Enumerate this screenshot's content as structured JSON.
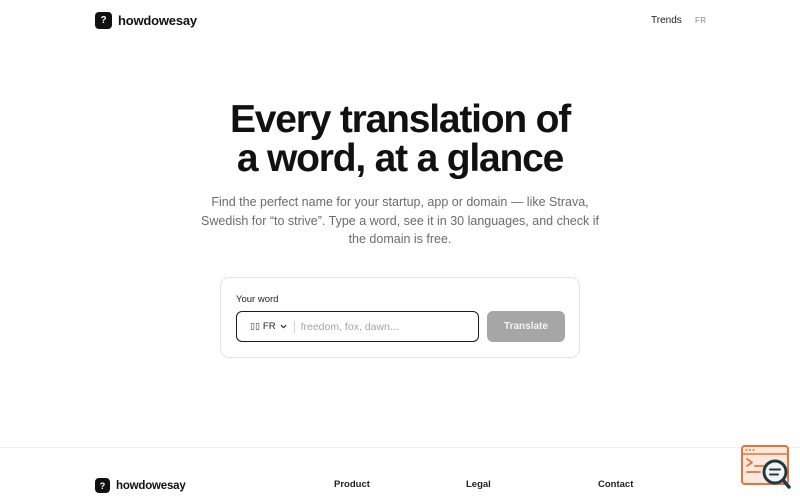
{
  "header": {
    "logo_glyph": "?",
    "brand": "howdowesay",
    "nav": {
      "trends": "Trends",
      "lang": "FR"
    }
  },
  "hero": {
    "title_line1": "Every translation of",
    "title_line2": "a word, at a glance",
    "subtitle": "Find the perfect name for your startup, app or domain — like Strava, Swedish for “to strive”. Type a word, see it in 30 languages, and check if the domain is free."
  },
  "search": {
    "label": "Your word",
    "flag": "▯▯",
    "lang": "FR",
    "value": "",
    "placeholder": "freedom, fox, dawn...",
    "button": "Translate"
  },
  "footer": {
    "logo_glyph": "?",
    "brand": "howdowesay",
    "columns": [
      "Product",
      "Legal",
      "Contact"
    ]
  },
  "colors": {
    "text": "#111111",
    "muted": "#6b6b6b",
    "button_disabled": "#a6a6a6",
    "widget_accent": "#e8733a",
    "widget_dark": "#1f3a44"
  },
  "icons": {
    "logo": "question-mark-badge-icon",
    "lang_dropdown": "chevron-down-icon",
    "widget": "chat-search-icon"
  }
}
